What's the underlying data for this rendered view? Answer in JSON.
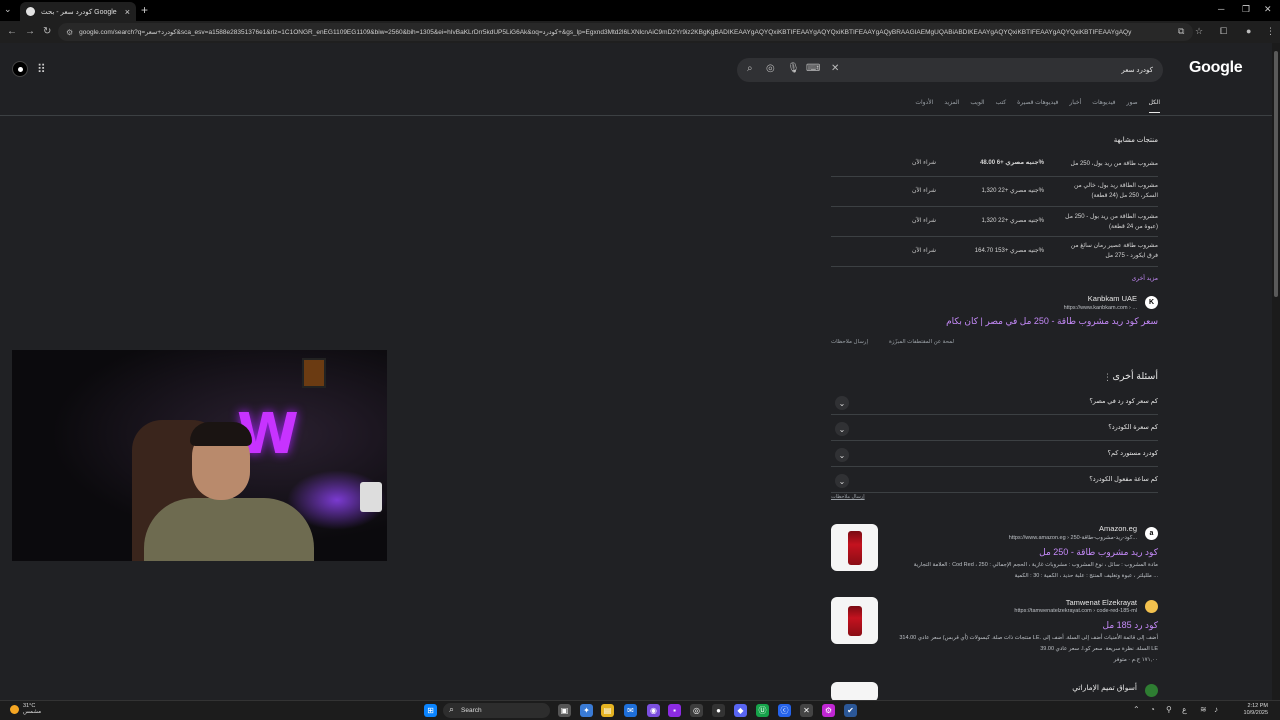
{
  "browser": {
    "tab_title": "كودرد سعر - بحث Google",
    "url": "google.com/search?q=كودرد+سعر&sca_esv=a1588e28351376e1&rlz=1C1ONGR_enEG1109EG1109&biw=2560&bih=1305&ei=hIvBaKLrDrr5kdUP5LiG6Ak&oq=كودرد+&gs_lp=Egxnd3Mtd2l6LXNlcnAiC9mD2Yr9iz2KBgKgBADIKEAAYgAQYQxiKBTIFEAAYgAQYQxiKBTIFEAAYgAQyBRAAGIAEMgUQABiABDIKEAAYgAQYQxiKBTIFEAAYgAQYQxiKBTIFEAAYgAQy"
  },
  "search": {
    "query": "كودرد سعر",
    "logo": "Google"
  },
  "tabs": [
    "الكل",
    "صور",
    "فيديوهات",
    "أخبار",
    "فيديوهات قصيرة",
    "كتب",
    "الويب",
    "المزيد",
    "الأدوات"
  ],
  "products": {
    "title": "منتجات مشابهة",
    "buy_label": "شراء الآن",
    "rows": [
      {
        "name": "مشروب طاقة من ريد بول، 250 مل",
        "price": "48.00 جنيه مصري +6%"
      },
      {
        "name": "مشروب الطاقة ريد بول، خالي من السكر، 250 مل (24 قطعة)",
        "price": "1,320 جنيه مصري +22%"
      },
      {
        "name": "مشروب الطاقة من ريد بول - 250 مل (عبوة من 24 قطعة)",
        "price": "1,320 جنيه مصري +22%"
      },
      {
        "name": "مشروب طاقة عصير رمان سائغ من فرق ايكورد - 275 مل",
        "price": "164.70 جنيه مصري +153%"
      }
    ],
    "more": "مزيد أخرى"
  },
  "result1": {
    "site": "Kanbkam UAE",
    "url": "https://www.kanbkam.com › ...",
    "title": "سعر كود ريد مشروب طاقة - 250 مل في مصر | كان بكام",
    "favicon": "K"
  },
  "feedback": {
    "send": "إرسال ملاحظات",
    "about": "لمحة عن المقتطفات المبرّزة"
  },
  "paa": {
    "title": "أسئلة أخرى",
    "questions": [
      "كم سعر كود رد في مصر؟",
      "كم سعرة الكودرد؟",
      "كودرد مستورد كم؟",
      "كم ساعة مفعول الكودرد؟"
    ],
    "feedback": "إرسال ملاحظات"
  },
  "result2": {
    "site": "Amazon.eg",
    "url": "https://www.amazon.eg › كود-ريد-مشروب-طاقة-250...",
    "title": "كود ريد مشروب طاقة - 250 مل",
    "snippet1": "العلامة التجارية : Cod Red ، مادة المشروب : سائل ، نوع المشروب : مشروبات غازية ، الحجم الإجمالي : 250",
    "snippet2": "ملليلتر ، عبوة وتغليف المنتج : علبة حديد ، الكمية : 30 : الكمية ...",
    "favicon": "a"
  },
  "result3": {
    "site": "Tamwenat Elzekrayat",
    "url": "https://tamwenatelzekrayat.com › code-red-185-ml",
    "title": "كود رد 185 مل",
    "snippet1": "منتجات ذات صلة. كبسولات (أي قربس) سعر عادي 314.00 LE. أضف إلى قائمة الأمنيات أضف إلى السلة. أضف إلى",
    "snippet2": "السلة. نظرة سريعة. سعر كو.ا. سعر عادي 39.00 LE",
    "snippet3": "١٧١,٠٠ ج.م · متوفر"
  },
  "result4": {
    "site": "أسواق تميم الإماراتي"
  },
  "taskbar": {
    "temp": "31°C",
    "weather": "مشمس",
    "search": "Search",
    "time": "2:12 PM",
    "date": "10/9/2025",
    "lang": "ع"
  },
  "colors": {
    "page_bg": "#202124",
    "link_visited": "#c58af9",
    "text": "#e8e8e8"
  }
}
